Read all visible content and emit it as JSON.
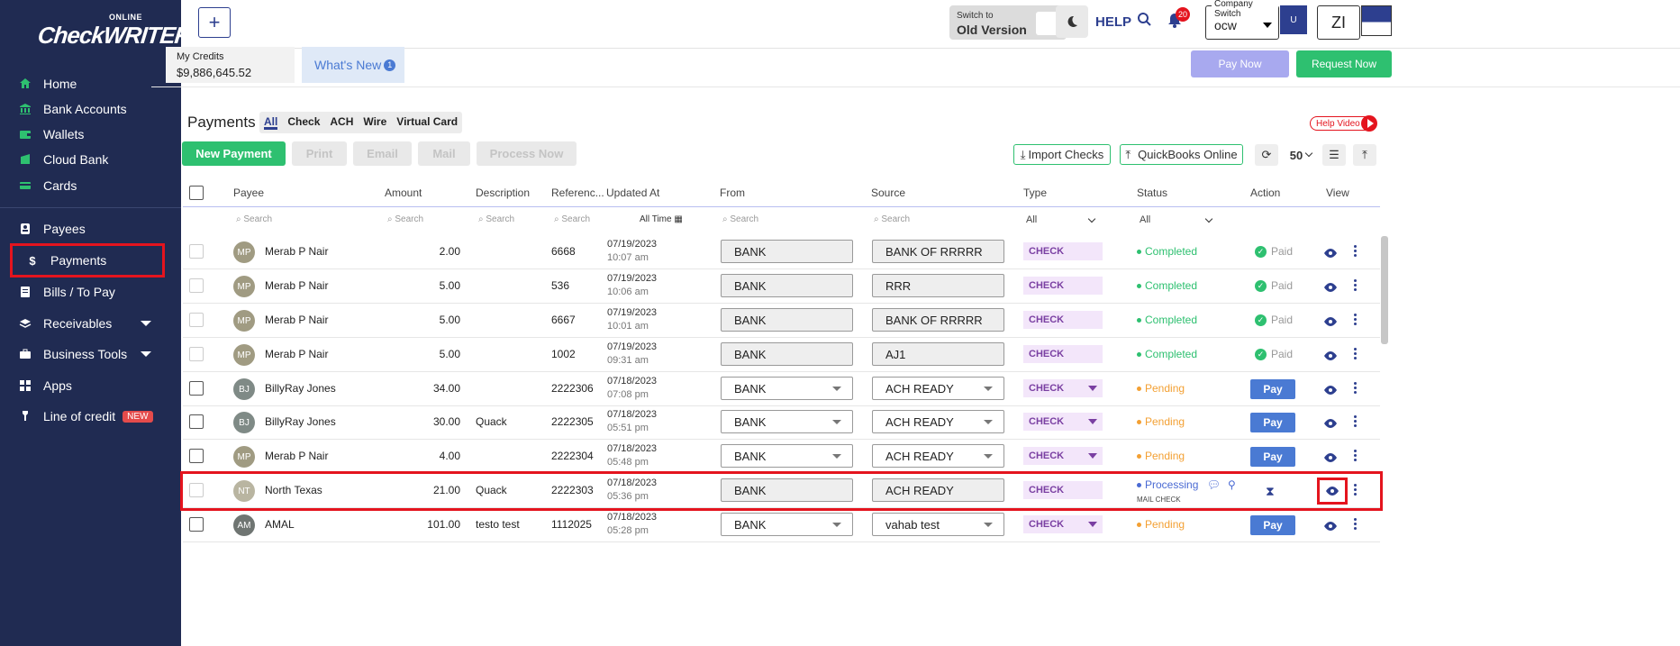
{
  "sidebar": {
    "logo_small": "ONLINE",
    "logo_main": "CheckWRITER",
    "items": [
      {
        "label": "Home",
        "icon": "home-icon"
      },
      {
        "label": "Bank Accounts",
        "icon": "bank-icon"
      },
      {
        "label": "Wallets",
        "icon": "wallet-icon"
      },
      {
        "label": "Cloud Bank",
        "icon": "cloud-bank-icon"
      },
      {
        "label": "Cards",
        "icon": "card-icon"
      },
      {
        "label": "Payees",
        "icon": "payee-icon"
      },
      {
        "label": "Payments",
        "icon": "dollar-icon"
      },
      {
        "label": "Bills / To Pay",
        "icon": "bill-icon"
      },
      {
        "label": "Receivables",
        "icon": "receivables-icon"
      },
      {
        "label": "Business Tools",
        "icon": "tools-icon"
      },
      {
        "label": "Apps",
        "icon": "apps-icon"
      },
      {
        "label": "Line of credit",
        "icon": "credit-icon",
        "badge": "NEW"
      }
    ]
  },
  "topbar": {
    "plus": "+",
    "switch_line1": "Switch to",
    "switch_line2": "Old Version",
    "help": "HELP",
    "notif_count": "20",
    "company_label": "Company Switch",
    "company_value": "ocw",
    "company_logo_text": "U",
    "user_initials": "ZI"
  },
  "credits": {
    "label": "My Credits",
    "value": "$9,886,645.52"
  },
  "whats_new": {
    "label": "What's New",
    "count": "1"
  },
  "actions": {
    "pay_now": "Pay Now",
    "request_now": "Request Now"
  },
  "payments": {
    "title": "Payments",
    "tabs": [
      "All",
      "Check",
      "ACH",
      "Wire",
      "Virtual Card"
    ],
    "help_video": "Help Video",
    "buttons": {
      "new_payment": "New Payment",
      "print": "Print",
      "email": "Email",
      "mail": "Mail",
      "process_now": "Process Now"
    },
    "import_checks": "Import Checks",
    "quickbooks": "QuickBooks Online",
    "page_size": "50"
  },
  "table": {
    "columns": [
      "Payee",
      "Amount",
      "Description",
      "Referenc...",
      "Updated At",
      "From",
      "Source",
      "Type",
      "Status",
      "Action",
      "View"
    ],
    "search_placeholder": "Search",
    "updated_filter": "All Time",
    "type_filter": "All",
    "status_filter": "All",
    "rows": [
      {
        "initials": "MP",
        "payee": "Merab P Nair",
        "amount": "2.00",
        "description": "",
        "ref": "6668",
        "date": "07/19/2023",
        "time": "10:07 am",
        "from": "BANK",
        "source": "BANK OF RRRRR",
        "type": "CHECK",
        "status": "Completed",
        "action": "Paid"
      },
      {
        "initials": "MP",
        "payee": "Merab P Nair",
        "amount": "5.00",
        "description": "",
        "ref": "536",
        "date": "07/19/2023",
        "time": "10:06 am",
        "from": "BANK",
        "source": "RRR",
        "type": "CHECK",
        "status": "Completed",
        "action": "Paid"
      },
      {
        "initials": "MP",
        "payee": "Merab P Nair",
        "amount": "5.00",
        "description": "",
        "ref": "6667",
        "date": "07/19/2023",
        "time": "10:01 am",
        "from": "BANK",
        "source": "BANK OF RRRRR",
        "type": "CHECK",
        "status": "Completed",
        "action": "Paid"
      },
      {
        "initials": "MP",
        "payee": "Merab P Nair",
        "amount": "5.00",
        "description": "",
        "ref": "1002",
        "date": "07/19/2023",
        "time": "09:31 am",
        "from": "BANK",
        "source": "AJ1",
        "type": "CHECK",
        "status": "Completed",
        "action": "Paid"
      },
      {
        "initials": "BJ",
        "payee": "BillyRay Jones",
        "amount": "34.00",
        "description": "",
        "ref": "2222306",
        "date": "07/18/2023",
        "time": "07:08 pm",
        "from": "BANK",
        "source": "ACH READY",
        "type": "CHECK",
        "status": "Pending",
        "action": "Pay"
      },
      {
        "initials": "BJ",
        "payee": "BillyRay Jones",
        "amount": "30.00",
        "description": "Quack",
        "ref": "2222305",
        "date": "07/18/2023",
        "time": "05:51 pm",
        "from": "BANK",
        "source": "ACH READY",
        "type": "CHECK",
        "status": "Pending",
        "action": "Pay"
      },
      {
        "initials": "MP",
        "payee": "Merab P Nair",
        "amount": "4.00",
        "description": "",
        "ref": "2222304",
        "date": "07/18/2023",
        "time": "05:48 pm",
        "from": "BANK",
        "source": "ACH READY",
        "type": "CHECK",
        "status": "Pending",
        "action": "Pay"
      },
      {
        "initials": "NT",
        "payee": "North Texas",
        "amount": "21.00",
        "description": "Quack",
        "ref": "2222303",
        "date": "07/18/2023",
        "time": "05:36 pm",
        "from": "BANK",
        "source": "ACH READY",
        "type": "CHECK",
        "status": "Processing",
        "status_sub": "MAIL CHECK",
        "action": "hourglass"
      },
      {
        "initials": "AM",
        "payee": "AMAL",
        "amount": "101.00",
        "description": "testo test",
        "ref": "1112025",
        "date": "07/18/2023",
        "time": "05:28 pm",
        "from": "BANK",
        "source": "vahab test",
        "type": "CHECK",
        "status": "Pending",
        "action": "Pay"
      }
    ]
  },
  "colors": {
    "sidebar": "#202b52",
    "green": "#2ec070",
    "blue": "#2d3f8f",
    "highlight": "#e4141e",
    "pending": "#f3a033"
  }
}
